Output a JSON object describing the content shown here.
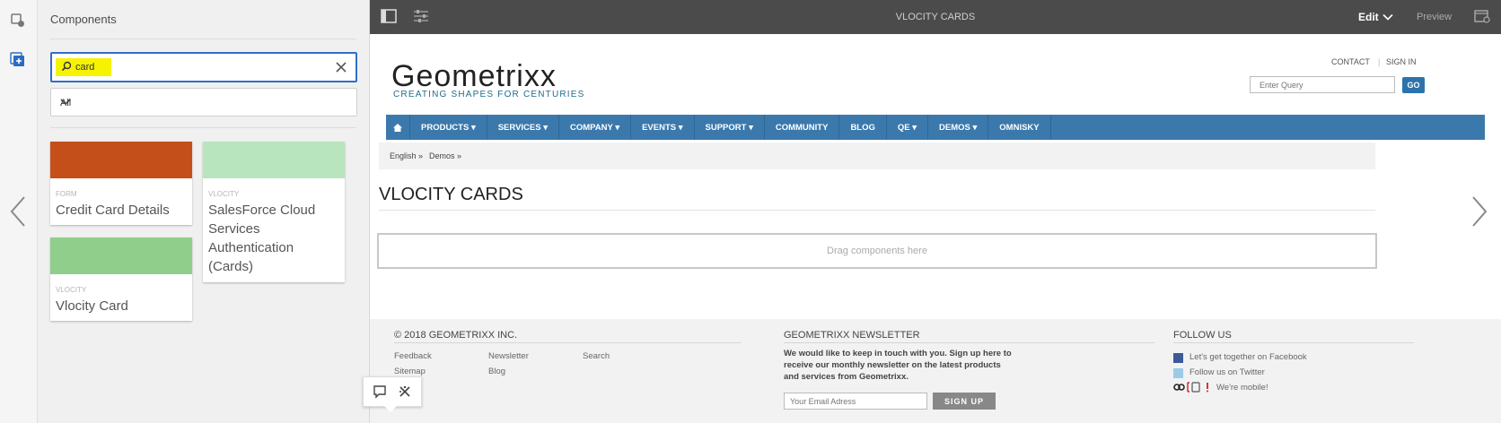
{
  "panel": {
    "title": "Components",
    "search_value": "card",
    "filter_selected": "All"
  },
  "components": [
    {
      "group": "FORM",
      "name": "Credit Card Details",
      "color": "#c44f1a"
    },
    {
      "group": "VLOCITY",
      "name": "SalesForce Cloud Services Authentication (Cards)",
      "color": "#b8e5bd"
    },
    {
      "group": "VLOCITY",
      "name": "Vlocity Card",
      "color": "#8fcf8b"
    }
  ],
  "topbar": {
    "page_title": "VLOCITY CARDS",
    "edit_label": "Edit",
    "preview_label": "Preview"
  },
  "site": {
    "logo_word": "Geometrixx",
    "logo_tagline": "CREATING SHAPES FOR CENTURIES",
    "contact": "CONTACT",
    "separator": "|",
    "signin": "SIGN IN",
    "query_placeholder": "Enter Query",
    "go_label": "GO",
    "nav": [
      "PRODUCTS ▾",
      "SERVICES ▾",
      "COMPANY ▾",
      "EVENTS ▾",
      "SUPPORT ▾",
      "COMMUNITY",
      "BLOG",
      "QE ▾",
      "DEMOS ▾",
      "OMNISKY"
    ],
    "breadcrumbs": [
      "English »",
      "Demos »"
    ],
    "heading": "VLOCITY CARDS",
    "dropzone": "Drag components here"
  },
  "footer": {
    "copyright": "© 2018 GEOMETRIXX INC.",
    "links_col1": [
      "Feedback",
      "Sitemap"
    ],
    "links_col2": [
      "Newsletter",
      "Blog"
    ],
    "links_col3": [
      "Search"
    ],
    "newsletter_title": "GEOMETRIXX NEWSLETTER",
    "newsletter_text": "We would like to keep in touch with you. Sign up here to receive our monthly newsletter on the latest products and services from Geometrixx.",
    "email_placeholder": "Your Email Adress",
    "signup_label": "SIGN UP",
    "follow_title": "FOLLOW US",
    "follow_links": [
      "Let's get together on Facebook",
      "Follow us on Twitter",
      "We're mobile!"
    ]
  },
  "colors": {
    "accent": "#326ec8",
    "nav_bg": "#3b79ad",
    "topbar_bg": "#4b4b4b",
    "search_highlight": "#f6f300"
  }
}
